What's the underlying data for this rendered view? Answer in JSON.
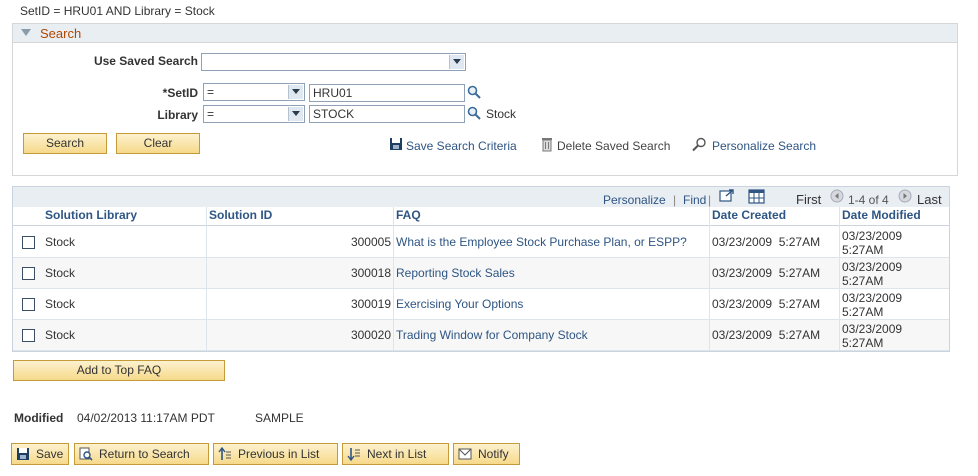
{
  "criteria_text": "SetID = HRU01 AND Library = Stock",
  "search": {
    "title": "Search",
    "use_saved_search_label": "Use Saved Search",
    "use_saved_search_value": "",
    "setid_label": "*SetID",
    "setid_operator": "=",
    "setid_value": "HRU01",
    "library_label": "Library",
    "library_operator": "=",
    "library_value": "STOCK",
    "library_description": "Stock",
    "search_button": "Search",
    "clear_button": "Clear",
    "save_criteria": "Save Search Criteria",
    "delete_saved": "Delete Saved Search",
    "personalize_search": "Personalize Search"
  },
  "grid": {
    "personalize": "Personalize",
    "separator": "|",
    "find": "Find",
    "first": "First",
    "range": "1-4 of 4",
    "last": "Last",
    "columns": [
      "Solution Library",
      "Solution ID",
      "FAQ",
      "Date Created",
      "Date Modified"
    ],
    "rows": [
      {
        "library": "Stock",
        "id": "300005",
        "faq": "What is the Employee Stock Purchase Plan, or ESPP?",
        "created": "03/23/2009  5:27AM",
        "modified_date": "03/23/2009",
        "modified_time": "5:27AM"
      },
      {
        "library": "Stock",
        "id": "300018",
        "faq": "Reporting Stock Sales",
        "created": "03/23/2009  5:27AM",
        "modified_date": "03/23/2009",
        "modified_time": "5:27AM"
      },
      {
        "library": "Stock",
        "id": "300019",
        "faq": "Exercising Your Options",
        "created": "03/23/2009  5:27AM",
        "modified_date": "03/23/2009",
        "modified_time": "5:27AM"
      },
      {
        "library": "Stock",
        "id": "300020",
        "faq": "Trading Window for Company Stock",
        "created": "03/23/2009  5:27AM",
        "modified_date": "03/23/2009",
        "modified_time": "5:27AM"
      }
    ]
  },
  "add_top_faq": "Add to Top FAQ",
  "modified": {
    "label": "Modified",
    "value": "04/02/2013 11:17AM PDT",
    "user": "SAMPLE"
  },
  "toolbar": {
    "save": "Save",
    "return": "Return to Search",
    "previous": "Previous in List",
    "next": "Next in List",
    "notify": "Notify"
  },
  "colors": {
    "accent_link": "#2e5583",
    "button_fill": "#f6d98a",
    "header_text": "#b04700"
  }
}
